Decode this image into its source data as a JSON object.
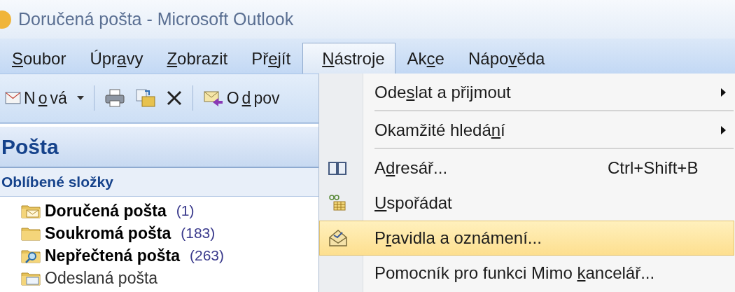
{
  "window": {
    "title": "Doručená pošta - Microsoft Outlook"
  },
  "menu_bar": [
    {
      "key": "S",
      "post": "oubor",
      "selected": false
    },
    {
      "pre": "Úpr",
      "key": "a",
      "post": "vy",
      "selected": false
    },
    {
      "key": "Z",
      "post": "obrazit",
      "selected": false
    },
    {
      "pre": "Př",
      "key": "e",
      "post": "jít",
      "selected": false
    },
    {
      "key": "N",
      "post": "ástroje",
      "selected": true
    },
    {
      "pre": "Ak",
      "key": "c",
      "post": "e",
      "selected": false
    },
    {
      "pre": "Nápo",
      "key": "v",
      "post": "ěda",
      "selected": false
    }
  ],
  "toolbar": {
    "new_button": {
      "pre": "N",
      "key": "o",
      "post": "vá"
    },
    "reply_button": {
      "pre": "O",
      "key": "d",
      "post": "pov"
    }
  },
  "navigation": {
    "header": "Pošta",
    "section": "Oblíbené složky",
    "folders": [
      {
        "kind": "inbox",
        "name": "Doručená pošta",
        "count": "(1)",
        "unread": true
      },
      {
        "kind": "folder",
        "name": "Soukromá pošta",
        "count": "(183)",
        "unread": true
      },
      {
        "kind": "search",
        "name": "Nepřečtená pošta",
        "count": "(263)",
        "unread": true
      },
      {
        "kind": "sent",
        "name": "Odeslaná pošta",
        "unread": false
      }
    ]
  },
  "dropdown": [
    {
      "kind": "submenu",
      "pre": "Ode",
      "key": "s",
      "post": "lat a přijmout",
      "separator_after": true,
      "selected": false
    },
    {
      "kind": "submenu",
      "pre": "Okamžité hledá",
      "key": "n",
      "post": "í",
      "separator_after": true,
      "selected": false
    },
    {
      "kind": "command",
      "pre": "A",
      "key": "d",
      "post": "resář...",
      "shortcut": "Ctrl+Shift+B",
      "separator_after": false,
      "selected": false
    },
    {
      "kind": "command",
      "key": "U",
      "post": "spořádat",
      "separator_after": false,
      "selected": false
    },
    {
      "kind": "command",
      "pre": "P",
      "key": "r",
      "post": "avidla a oznámení...",
      "separator_after": false,
      "selected": true
    },
    {
      "kind": "command",
      "pre": "Pomocník pro funkci Mimo ",
      "key": "k",
      "post": "ancelář...",
      "separator_after": false,
      "selected": false
    }
  ]
}
